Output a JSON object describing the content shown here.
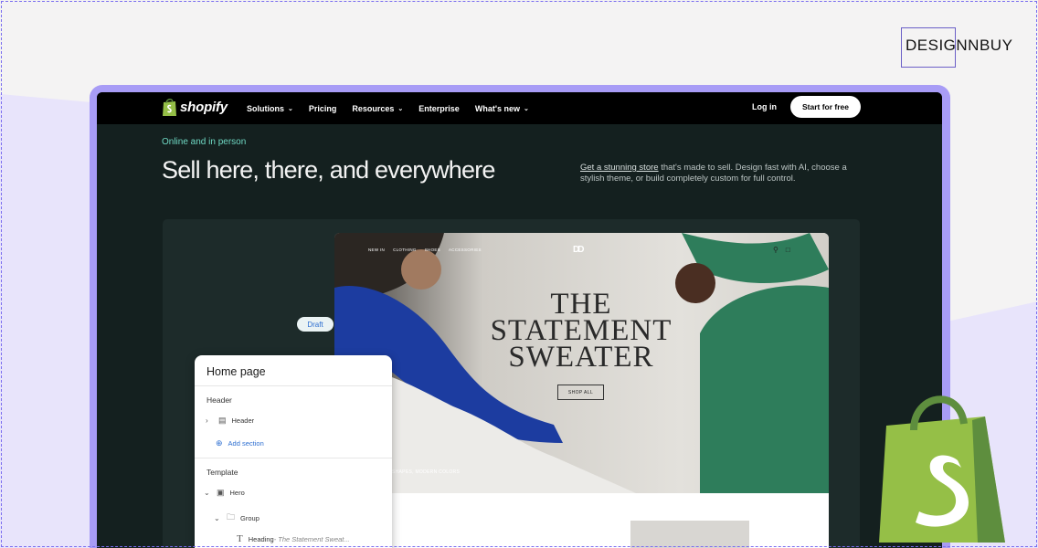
{
  "brand": {
    "name": "DESIGNNBUY"
  },
  "nav": {
    "logo_text": "shopify",
    "items": [
      {
        "label": "Solutions",
        "has_dropdown": true
      },
      {
        "label": "Pricing",
        "has_dropdown": false
      },
      {
        "label": "Resources",
        "has_dropdown": true
      },
      {
        "label": "Enterprise",
        "has_dropdown": false
      },
      {
        "label": "What's new",
        "has_dropdown": true
      }
    ],
    "login": "Log in",
    "cta": "Start for free"
  },
  "hero": {
    "eyebrow": "Online and in person",
    "title": "Sell here, there, and everywhere",
    "desc_link": "Get a stunning store",
    "desc_rest": " that's made to sell. Design fast with AI, choose a stylish theme, or build completely custom for full control."
  },
  "badge": {
    "draft": "Draft"
  },
  "store": {
    "nav": [
      "NEW IN",
      "CLOTHING",
      "SHOES",
      "ACCESSORIES"
    ],
    "logo": "DD",
    "headline_lines": [
      "THE",
      "STATEMENT",
      "SWEATER"
    ],
    "shop_all": "SHOP ALL",
    "caption": "SHAPES, MODERN COLORS"
  },
  "editor_panel": {
    "title": "Home page",
    "header_section": "Header",
    "header_item": "Header",
    "add_section": "Add section",
    "template_section": "Template",
    "hero_item": "Hero",
    "group_item": "Group",
    "heading_item": "Heading",
    "heading_value": " - The Statement Sweat..."
  },
  "colors": {
    "accent": "#a89cf6",
    "screen_bg": "#14201f",
    "eyebrow": "#6fd8c3",
    "shopify_green": "#95bf47",
    "link_blue": "#2e6fd1"
  }
}
